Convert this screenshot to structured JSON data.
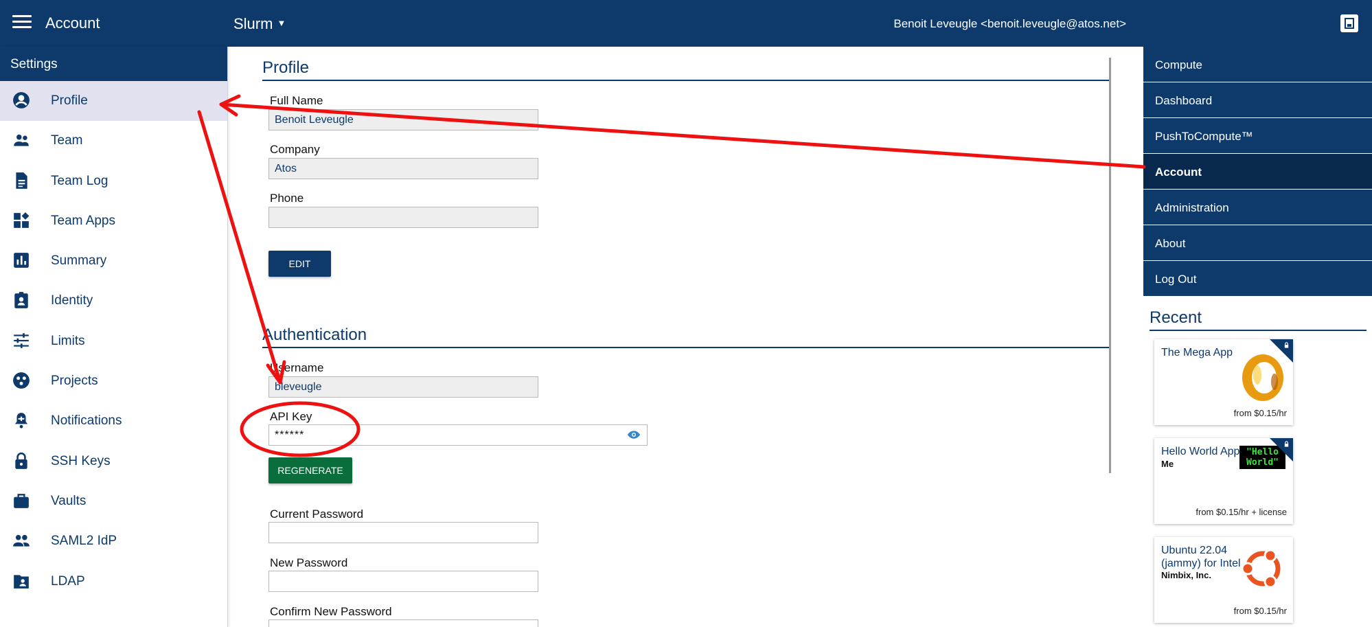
{
  "topbar": {
    "title": "Account",
    "app_name": "Slurm",
    "app_caret": "▼",
    "user": "Benoit Leveugle <benoit.leveugle@atos.net>"
  },
  "sidebar": {
    "header": "Settings",
    "items": [
      {
        "label": "Profile",
        "icon": "account-circle-icon"
      },
      {
        "label": "Team",
        "icon": "team-icon"
      },
      {
        "label": "Team Log",
        "icon": "document-icon"
      },
      {
        "label": "Team Apps",
        "icon": "widgets-icon"
      },
      {
        "label": "Summary",
        "icon": "bar-chart-icon"
      },
      {
        "label": "Identity",
        "icon": "badge-icon"
      },
      {
        "label": "Limits",
        "icon": "sliders-icon"
      },
      {
        "label": "Projects",
        "icon": "projects-icon"
      },
      {
        "label": "Notifications",
        "icon": "bell-icon"
      },
      {
        "label": "SSH Keys",
        "icon": "lock-icon"
      },
      {
        "label": "Vaults",
        "icon": "briefcase-icon"
      },
      {
        "label": "SAML2 IdP",
        "icon": "people-icon"
      },
      {
        "label": "LDAP",
        "icon": "folder-account-icon"
      }
    ]
  },
  "profile": {
    "title": "Profile",
    "full_name_label": "Full Name",
    "full_name_value": "Benoit Leveugle",
    "company_label": "Company",
    "company_value": "Atos",
    "phone_label": "Phone",
    "phone_value": "",
    "edit_label": "EDIT"
  },
  "authentication": {
    "title": "Authentication",
    "username_label": "Username",
    "username_value": "bleveugle",
    "api_key_label": "API Key",
    "api_key_value": "******",
    "regenerate_label": "REGENERATE",
    "current_password_label": "Current Password",
    "new_password_label": "New Password",
    "confirm_password_label": "Confirm New Password"
  },
  "rightnav": {
    "items": [
      {
        "label": "Compute",
        "active": false
      },
      {
        "label": "Dashboard",
        "active": false
      },
      {
        "label": "PushToCompute™",
        "active": false
      },
      {
        "label": "Account",
        "active": true
      },
      {
        "label": "Administration",
        "active": false
      },
      {
        "label": "About",
        "active": false
      },
      {
        "label": "Log Out",
        "active": false
      }
    ]
  },
  "recent": {
    "title": "Recent",
    "cards": [
      {
        "name": "The Mega App",
        "vendor": "",
        "price": "from $0.15/hr",
        "locked": true,
        "icon": "gold-ring-icon"
      },
      {
        "name": "Hello World App",
        "vendor": "Me",
        "price": "from $0.15/hr + license",
        "locked": true,
        "icon": "hello-world-terminal-icon",
        "icon_text": "\"Hello World\""
      },
      {
        "name": "Ubuntu 22.04 (jammy) for Intel",
        "vendor": "Nimbix, Inc.",
        "price": "from $0.15/hr",
        "locked": false,
        "icon": "ubuntu-logo-icon"
      }
    ]
  },
  "colors": {
    "brand": "#0d3a6b",
    "active_sidebar": "#e1e1ef",
    "regenerate": "#0a6e3c",
    "annotation": "#ee1111"
  }
}
